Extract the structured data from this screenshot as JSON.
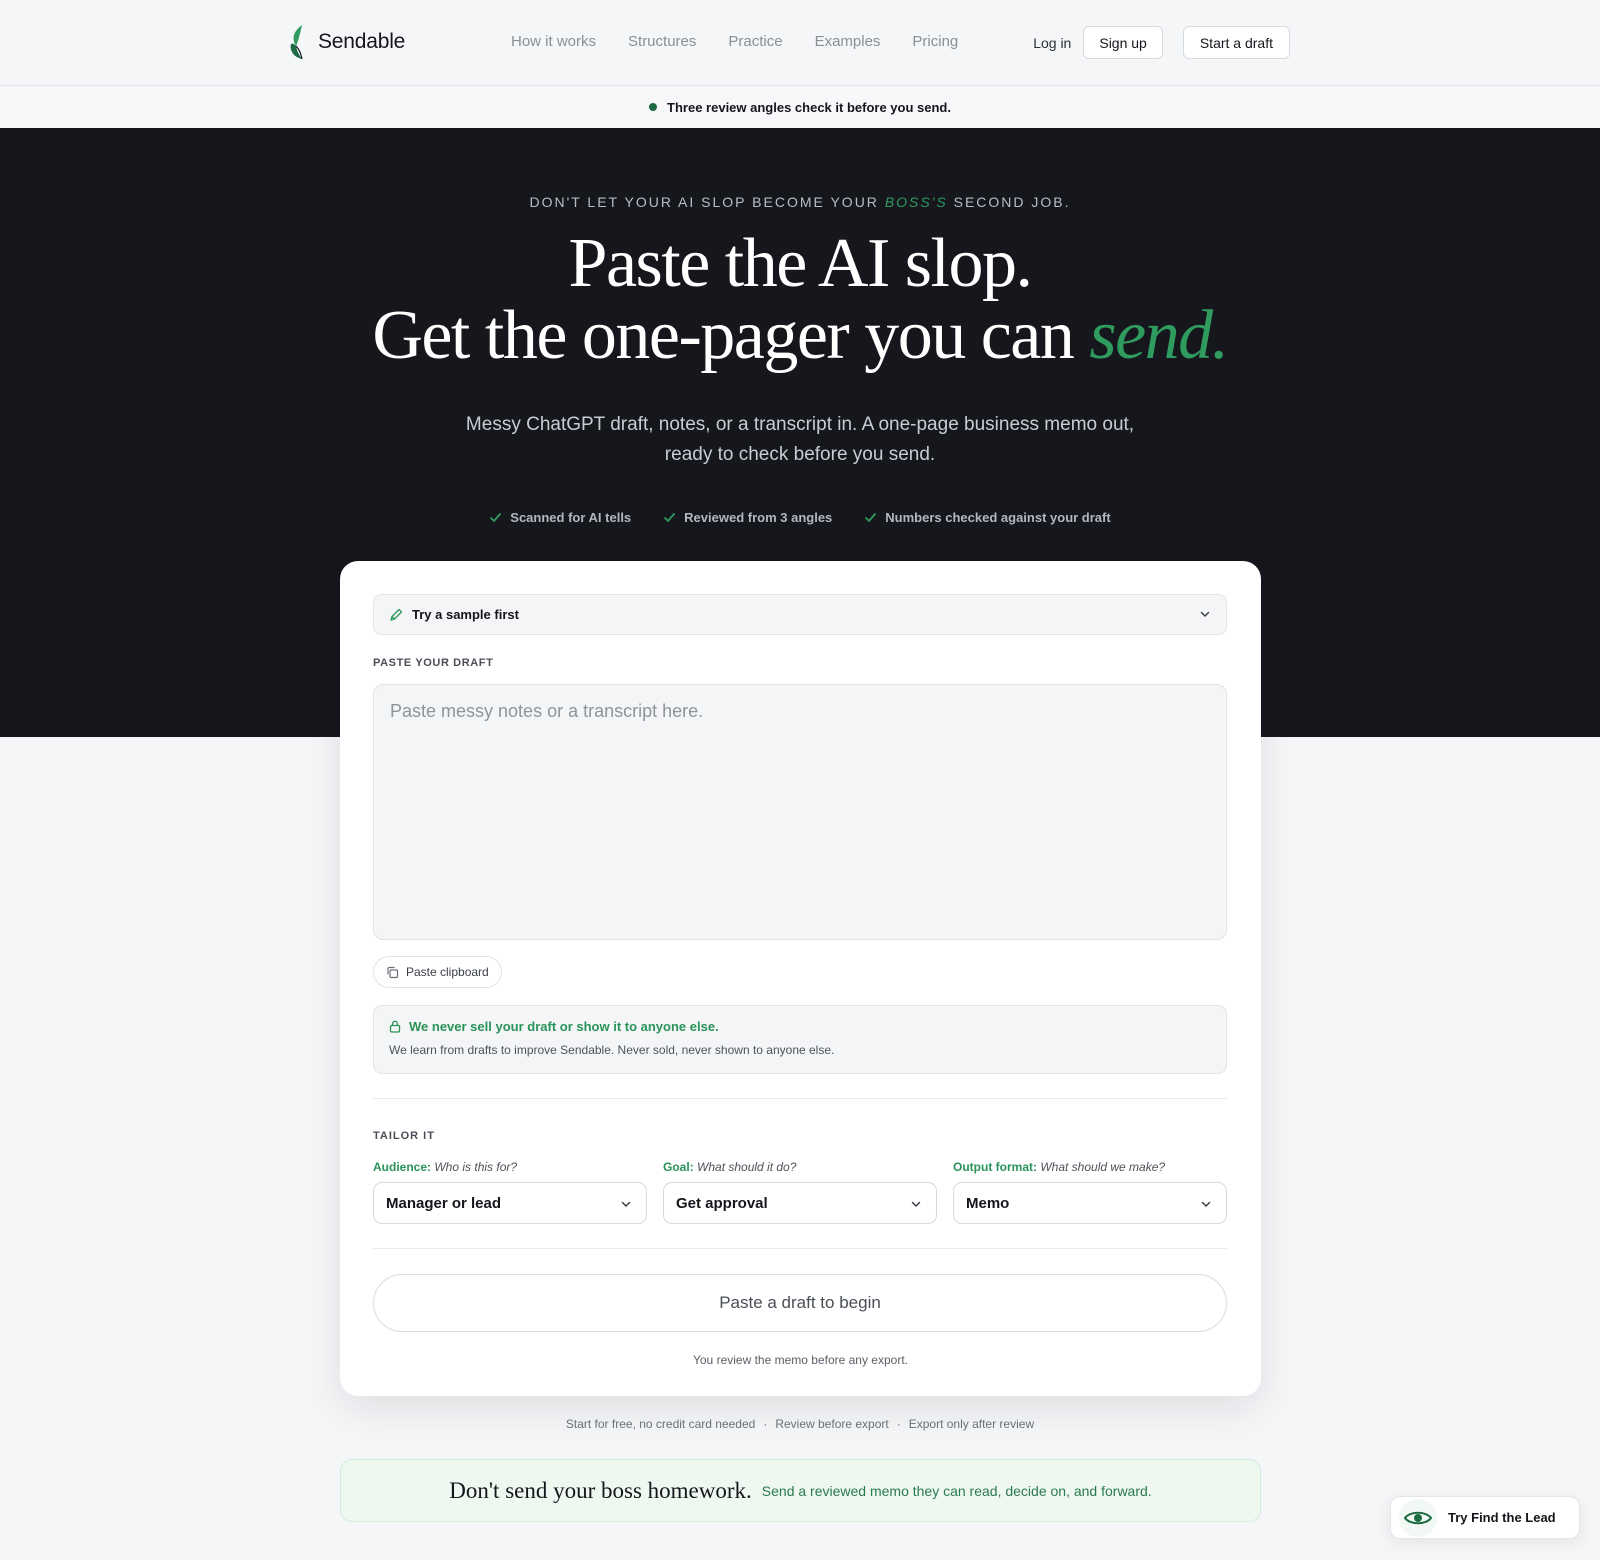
{
  "brand": {
    "name": "Sendable",
    "accent": "#2f9b5e",
    "dark": "#15171c"
  },
  "nav": {
    "links": [
      "How it works",
      "Structures",
      "Practice",
      "Examples",
      "Pricing"
    ],
    "login": "Log in",
    "signup": "Sign up",
    "start_draft": "Start a draft"
  },
  "banner": {
    "text": "Three review angles check it before you send."
  },
  "hero": {
    "eyebrow_pre": "DON'T LET YOUR AI SLOP BECOME YOUR",
    "eyebrow_em": "BOSS'S",
    "eyebrow_post": "SECOND JOB.",
    "title_line1": "Paste the AI slop.",
    "title_line2_pre": "Get the one-pager you can",
    "title_line2_accent": "send.",
    "subtitle_line1": "Messy ChatGPT draft, notes, or a transcript in. A one-page business memo out,",
    "subtitle_line2": "ready to check before you send.",
    "checks": [
      "Scanned for AI tells",
      "Reviewed from 3 angles",
      "Numbers checked against your draft"
    ]
  },
  "card": {
    "sample_label": "Try a sample first",
    "paste_label": "PASTE YOUR DRAFT",
    "textarea_placeholder": "Paste messy notes or a transcript here.",
    "paste_clipboard": "Paste clipboard",
    "privacy_title": "We never sell your draft or show it to anyone else.",
    "privacy_body": "We learn from drafts to improve Sendable. Never sold, never shown to anyone else.",
    "tailor_label": "TAILOR IT",
    "fields": [
      {
        "label": "Audience:",
        "hint": "Who is this for?",
        "value": "Manager or lead"
      },
      {
        "label": "Goal:",
        "hint": "What should it do?",
        "value": "Get approval"
      },
      {
        "label": "Output format:",
        "hint": "What should we make?",
        "value": "Memo"
      }
    ],
    "primary_button": "Paste a draft to begin",
    "note": "You review the memo before any export."
  },
  "trust": [
    "Start for free, no credit card needed",
    "·",
    "Review before export",
    "·",
    "Export only after review"
  ],
  "boss": {
    "title": "Don't send your boss homework.",
    "subtitle": "Send a reviewed memo they can read, decide on, and forward."
  },
  "fab": {
    "label": "Try Find the Lead",
    "icon": "eye-icon"
  }
}
